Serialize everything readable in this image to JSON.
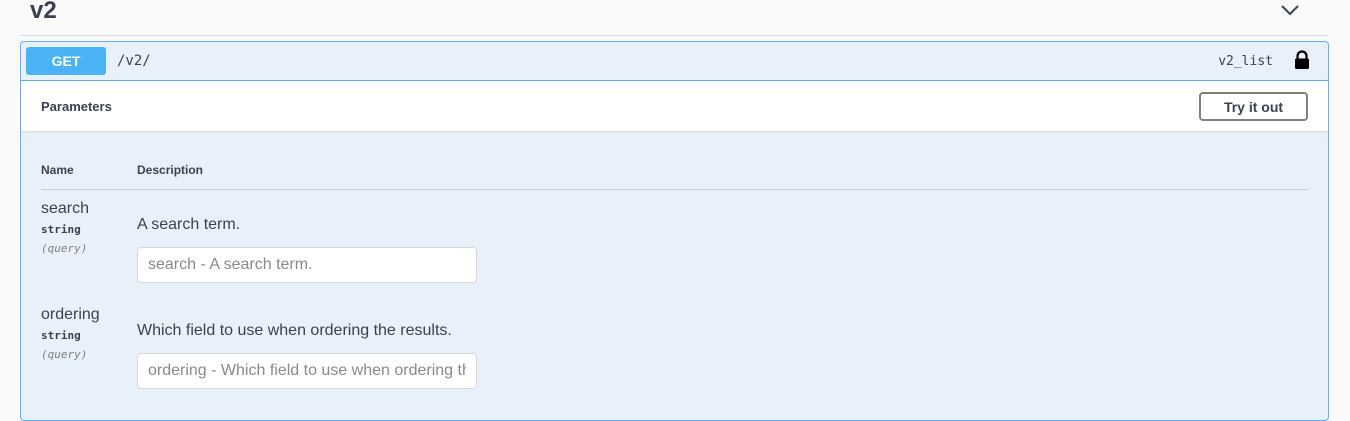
{
  "section": {
    "title": "v2",
    "toggle_icon": "chevron-down-icon"
  },
  "operation": {
    "method": "GET",
    "path": "/v2/",
    "operation_id": "v2_list",
    "lock_icon": "lock-icon",
    "method_color": "#49b3f5",
    "border_color": "#61affe"
  },
  "parameters": {
    "title": "Parameters",
    "try_button": "Try it out",
    "columns": {
      "name": "Name",
      "description": "Description"
    },
    "items": [
      {
        "name": "search",
        "type": "string",
        "in": "(query)",
        "description": "A search term.",
        "placeholder": "search - A search term."
      },
      {
        "name": "ordering",
        "type": "string",
        "in": "(query)",
        "description": "Which field to use when ordering the results.",
        "placeholder": "ordering - Which field to use when ordering the results."
      }
    ]
  }
}
